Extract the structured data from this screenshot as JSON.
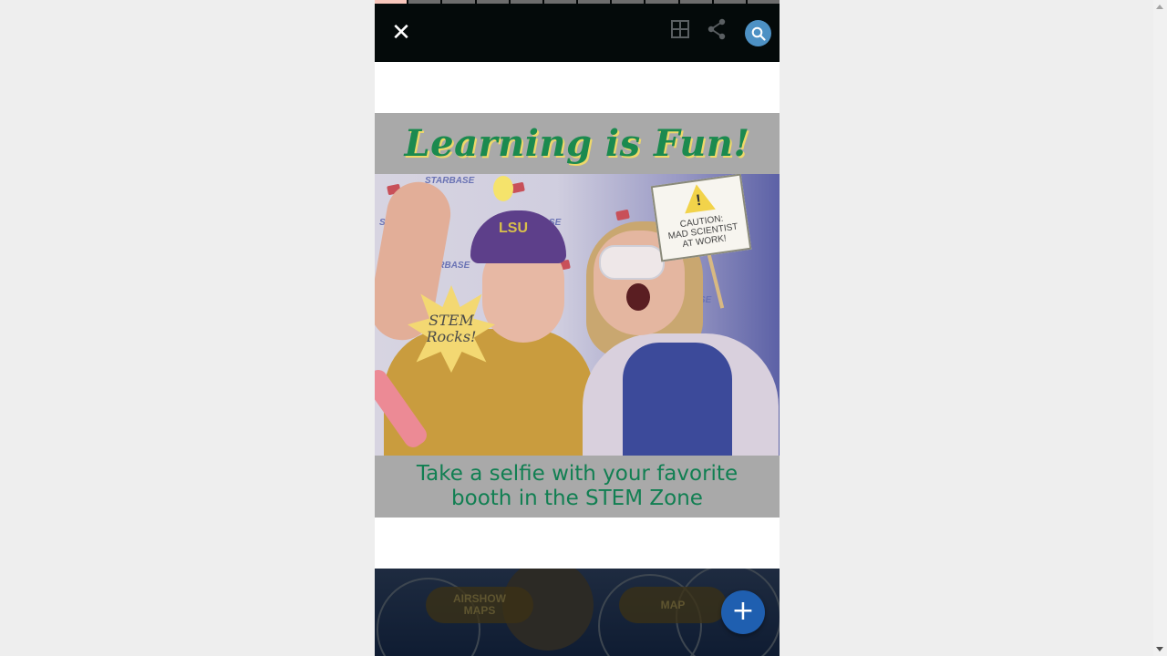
{
  "viewer": {
    "progress_segments": 12,
    "active_segment": 0,
    "close_icon_glyph": "✕",
    "icons": [
      "close-icon",
      "grid-icon",
      "share-icon",
      "search-icon"
    ]
  },
  "story": {
    "title": "Learning is Fun!",
    "caption": "Take a selfie with your favorite\nbooth in the STEM Zone",
    "hat_text": "LSU",
    "sign_text": "CAUTION:\nMAD SCIENTIST\nAT WORK!",
    "burst_text": "STEM\nRocks!",
    "backdrop_text": "STARBASE"
  },
  "bottom": {
    "pill_left": "AIRSHOW\nMAPS",
    "pill_right": "MAP",
    "fab_glyph": "+"
  },
  "colors": {
    "topbar": "#040a0a",
    "search_button": "#4d91c4",
    "fab": "#1f5fb0",
    "title_green": "#1b8a4f",
    "caption_green": "#117f52"
  }
}
